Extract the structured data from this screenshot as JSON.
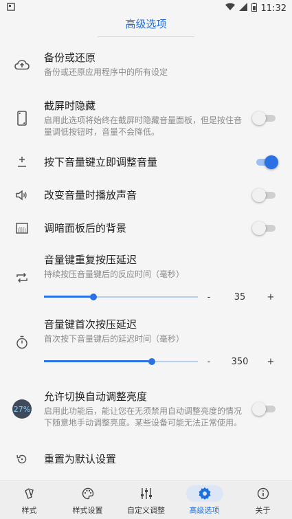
{
  "status_bar": {
    "time": "11:32"
  },
  "header": {
    "title": "高级选项"
  },
  "settings": {
    "backup": {
      "title": "备份或还原",
      "desc": "备份或还原应用程序中的所有设定"
    },
    "hide_screenshot": {
      "title": "截屏时隐藏",
      "desc": "启用此选项将始终在截屏时隐藏音量面板，但是按住音量调低按钮时，音量不会降低。",
      "on": false
    },
    "volume_key": {
      "title": "按下音量键立即调整音量",
      "on": true
    },
    "play_sound": {
      "title": "改变音量时播放声音",
      "on": false
    },
    "dim_background": {
      "title": "调暗面板后的背景",
      "on": false
    },
    "repeat_delay": {
      "title": "音量键重复按压延迟",
      "desc": "持续按压音量键后的反应时间（毫秒）",
      "value": "35",
      "fraction": 0.32,
      "minus": "-",
      "plus": "+"
    },
    "first_delay": {
      "title": "音量键首次按压延迟",
      "desc": "首次按下音量键后的延迟时间（毫秒）",
      "value": "350",
      "fraction": 0.7,
      "minus": "-",
      "plus": "+"
    },
    "auto_brightness": {
      "title": "允许切换自动调整亮度",
      "desc": "启用此功能后，能让您在无须禁用自动调整亮度的情况下随意地手动调整亮度。某些设备可能无法正常使用。",
      "badge": "27%",
      "on": false
    },
    "reset": {
      "title": "重置为默认设置"
    }
  },
  "bottom_nav": {
    "items": [
      {
        "label": "样式",
        "icon": "style-icon"
      },
      {
        "label": "样式设置",
        "icon": "palette-icon"
      },
      {
        "label": "自定义调整",
        "icon": "tune-icon"
      },
      {
        "label": "高级选项",
        "icon": "gear-icon"
      },
      {
        "label": "关于",
        "icon": "info-icon"
      }
    ],
    "active_index": 3
  },
  "colors": {
    "accent": "#2a72e3",
    "title": "#1e6fe0"
  }
}
